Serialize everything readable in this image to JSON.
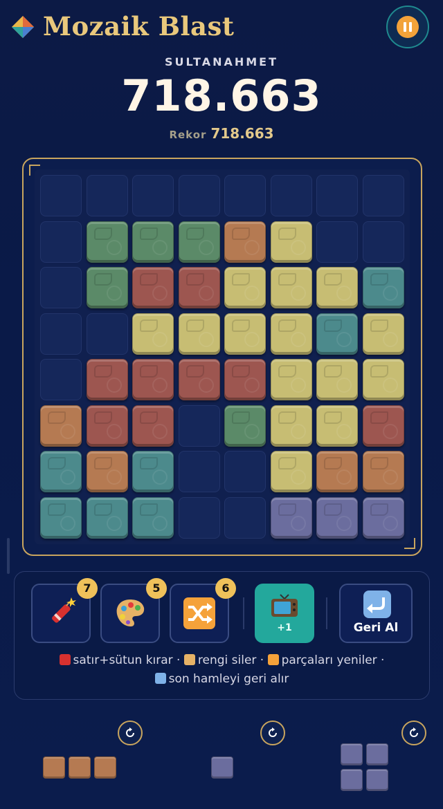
{
  "header": {
    "title": "Mozaik Blast",
    "pause_icon": "pause-icon",
    "level_name": "SULTANAHMET",
    "score": "718.663",
    "best_label": "Rekor",
    "best_value": "718.663"
  },
  "colors": {
    "green": "#5b8a68",
    "orange": "#b57a52",
    "yellow": "#c7bd73",
    "red": "#9d5650",
    "teal": "#4c8a8c",
    "purple": "#6b6d9e",
    "empty": "#15275a",
    "gold": "#c9a55e"
  },
  "board": {
    "rows": [
      [
        null,
        null,
        null,
        null,
        null,
        null,
        null,
        null
      ],
      [
        null,
        "green",
        "green",
        "green",
        "orange",
        "yellow",
        null,
        null
      ],
      [
        null,
        "green",
        "red",
        "red",
        "yellow",
        "yellow",
        "yellow",
        "teal"
      ],
      [
        null,
        null,
        "yellow",
        "yellow",
        "yellow",
        "yellow",
        "teal",
        "yellow"
      ],
      [
        null,
        "red",
        "red",
        "red",
        "red",
        "yellow",
        "yellow",
        "yellow"
      ],
      [
        "orange",
        "red",
        "red",
        null,
        "green",
        "yellow",
        "yellow",
        "red"
      ],
      [
        "teal",
        "orange",
        "teal",
        null,
        null,
        "yellow",
        "orange",
        "orange"
      ],
      [
        "teal",
        "teal",
        "teal",
        null,
        null,
        "purple",
        "purple",
        "purple"
      ]
    ]
  },
  "powerups": [
    {
      "name": "dynamite",
      "icon": "firecracker-icon",
      "count": "7"
    },
    {
      "name": "palette",
      "icon": "palette-icon",
      "count": "5"
    },
    {
      "name": "shuffle",
      "icon": "shuffle-icon",
      "count": "6"
    }
  ],
  "ad_button": {
    "icon": "tv-icon",
    "label": "+1"
  },
  "undo_button": {
    "icon": "undo-arrow-icon",
    "label": "Geri Al"
  },
  "help": {
    "line1_a": "satır+sütun kırar ·",
    "line1_b": "rengi siler ·",
    "line1_c": "parçaları yeniler ·",
    "line2": "son hamleyi geri alır"
  },
  "tray": [
    {
      "color": "orange",
      "cells": [
        [
          0,
          0
        ],
        [
          1,
          0
        ],
        [
          2,
          0
        ]
      ]
    },
    {
      "color": "purple",
      "cells": [
        [
          0,
          0
        ]
      ]
    },
    {
      "color": "purple",
      "cells": [
        [
          0,
          0
        ],
        [
          1,
          0
        ],
        [
          0,
          1
        ],
        [
          1,
          1
        ]
      ]
    }
  ]
}
